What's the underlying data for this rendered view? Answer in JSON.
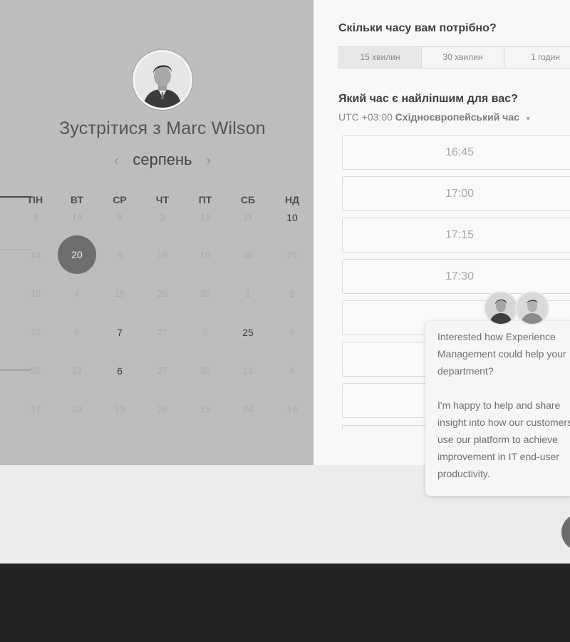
{
  "booking": {
    "title": "Зустрітися з Marc Wilson",
    "month": "серпень",
    "prev_arrow": "‹",
    "next_arrow": "›",
    "weekdays": [
      "ПН",
      "ВТ",
      "СР",
      "ЧТ",
      "ПТ",
      "СБ",
      "НД"
    ],
    "days": [
      [
        "9",
        "14",
        "9",
        "3",
        "13",
        "11",
        "10"
      ],
      [
        "14",
        "20",
        "5",
        "19",
        "10",
        "30",
        "25"
      ],
      [
        "15",
        "4",
        "15",
        "25",
        "30",
        "1",
        "3"
      ],
      [
        "12",
        "5",
        "7",
        "27",
        "5",
        "25",
        "9"
      ],
      [
        "26",
        "23",
        "6",
        "27",
        "30",
        "23",
        "6"
      ],
      [
        "17",
        "23",
        "13",
        "26",
        "15",
        "24",
        "19"
      ]
    ],
    "selected_day": "20",
    "emphasized_days": [
      "10",
      "7",
      "25",
      "6"
    ]
  },
  "scheduler": {
    "duration_question": "Скільки часу вам потрібно?",
    "durations": [
      "15 хвилин",
      "30 хвилин",
      "1 годин"
    ],
    "time_question": "Який час є найліпшим для вас?",
    "timezone_offset": "UTC +03:00",
    "timezone_name": "Східноєвропейський час",
    "timezone_caret": "▾",
    "slots": [
      "16:45",
      "17:00",
      "17:15",
      "17:30",
      "",
      "",
      ""
    ]
  },
  "chat": {
    "message_1_lines": [
      "Interested how Experience",
      "Management could help your",
      "department?"
    ],
    "message_2_lines": [
      "I'm happy to help and share",
      "insight into how our customers",
      "use our platform to achieve",
      "improvement in IT end-user",
      "productivity."
    ]
  },
  "colors": {
    "left_panel": "#bdbdbd",
    "selected_day": "#6e6e6e",
    "footer": "#222222"
  }
}
